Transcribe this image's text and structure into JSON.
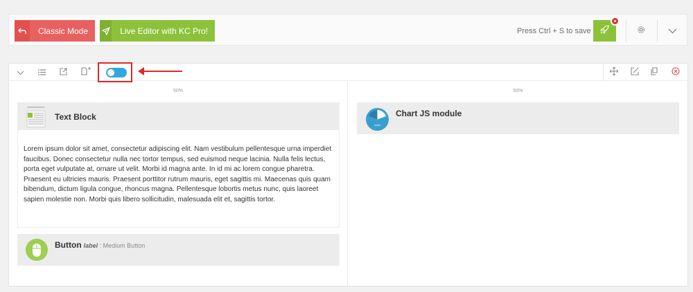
{
  "topbar": {
    "classic_label": "Classic Mode",
    "live_label": "Live Editor with KC Pro!",
    "save_hint": "Press Ctrl + S to save",
    "icons": [
      "undo-icon",
      "send-icon",
      "rocket-icon",
      "gear-icon",
      "chevron-down-icon"
    ],
    "colors": {
      "classic": "#e96060",
      "live": "#8cc23a",
      "badge": "#e03030"
    }
  },
  "builder": {
    "toggle_state": "on",
    "toggle_color": "#33a8e0",
    "left_icons": [
      "collapse-icon",
      "list-icon",
      "export-icon",
      "add-section-icon",
      "toggle-switch"
    ],
    "right_icons": [
      "move-icon",
      "edit-icon",
      "duplicate-icon",
      "delete-icon"
    ],
    "columns": [
      {
        "width_label": "50%",
        "elements": [
          {
            "title": "Text Block",
            "body": "Lorem ipsum dolor sit amet, consectetur adipiscing elit. Nam vestibulum pellentesque urna imperdiet faucibus. Donec consectetur nulla nec tortor tempus, sed euismod neque lacinia. Nulla felis lectus, porta eget vulputate at, ornare ut velit. Morbi id magna ante. In id mi ac lorem congue pharetra. Praesent eu ultricies mauris. Praesent porttitor rutrum mauris, eget sagittis mi. Maecenas quis quam bibendum, dictum ligula congue, rhoncus magna. Pellentesque lobortis metus nunc, quis laoreet sapien molestie non. Morbi quis libero sollicitudin, malesuada elit et, sagittis tortor."
          },
          {
            "title": "Button",
            "sub_label": "label",
            "sub_value": " : Medium Button"
          }
        ]
      },
      {
        "width_label": "50%",
        "elements": [
          {
            "title": "Chart JS module"
          }
        ]
      }
    ]
  },
  "annotation": {
    "color": "#e02828"
  }
}
